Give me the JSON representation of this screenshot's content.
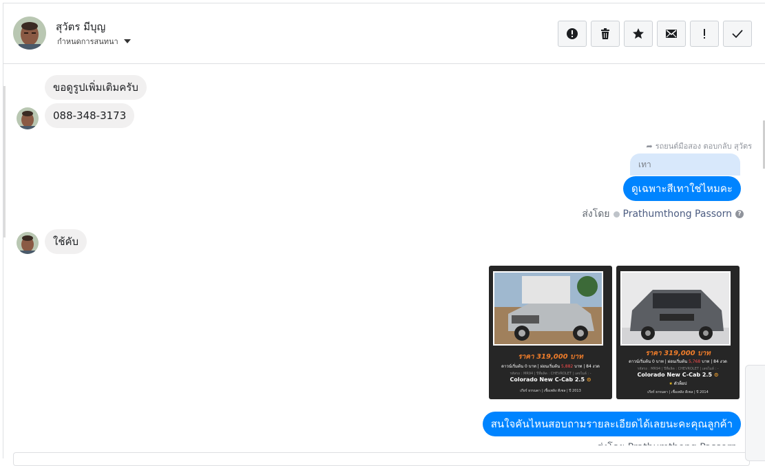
{
  "header": {
    "contact_name": "สุวัตร มีบุญ",
    "conversation_settings_label": "กำหนดการสนทนา",
    "tools": [
      {
        "name": "report-icon"
      },
      {
        "name": "trash-icon"
      },
      {
        "name": "star-icon"
      },
      {
        "name": "mail-icon"
      },
      {
        "name": "important-icon"
      },
      {
        "name": "check-icon"
      }
    ]
  },
  "thread": {
    "msg1": "ขอดูรูปเพิ่มเติมครับ",
    "msg2": "088-348-3173",
    "reply_meta": "รถยนต์มือสอง ตอบกลับ สุวัตร",
    "quoted_text": "เทา",
    "out1": "ดูเฉพาะสีเทาใช่ไหมคะ",
    "sent_by_prefix": "ส่งโดย",
    "agent_name": "Prathumthong Passorn",
    "msg3": "ใช้คับ",
    "out2": "สนใจคันไหนสอบถามรายละเอียดได้เลยนะคะคุณลูกค้า"
  },
  "cards": [
    {
      "price": "ราคา 319,000 บาท",
      "terms_a": "ดาวน์เริ่มต้น 0 บาท | ผ่อนเริ่มต้น",
      "monthly": "5,882",
      "terms_b": "บาท | 84 งวด",
      "meta": "รหัสรถ : MR94 | ปีที่ผลิต : CHEVROLET | เลขไมล์ : -",
      "model": "Colorado New C-Cab 2.5",
      "badge": "",
      "foot": "เกียร์ ธรรมดา | เชื้อเพลิง ดีเซล | ปี 2013"
    },
    {
      "price": "ราคา 319,000 บาท",
      "terms_a": "ดาวน์เริ่มต้น 0 บาท | ผ่อนเริ่มต้น",
      "monthly": "5,768",
      "terms_b": "บาท | 84 งวด",
      "meta": "รหัสรถ : MR94 | ปีที่ผลิต : CHEVROLET | เลขไมล์ : -",
      "model": "Colorado New C-Cab 2.5",
      "badge": "ตัวท็อป",
      "foot": "เกียร์ ธรรมดา | เชื้อเพลิง ดีเซล | ปี 2014"
    }
  ],
  "colors": {
    "accent": "#0084ff",
    "incoming_bubble": "#f1f0f0",
    "price": "#f07d2a"
  }
}
